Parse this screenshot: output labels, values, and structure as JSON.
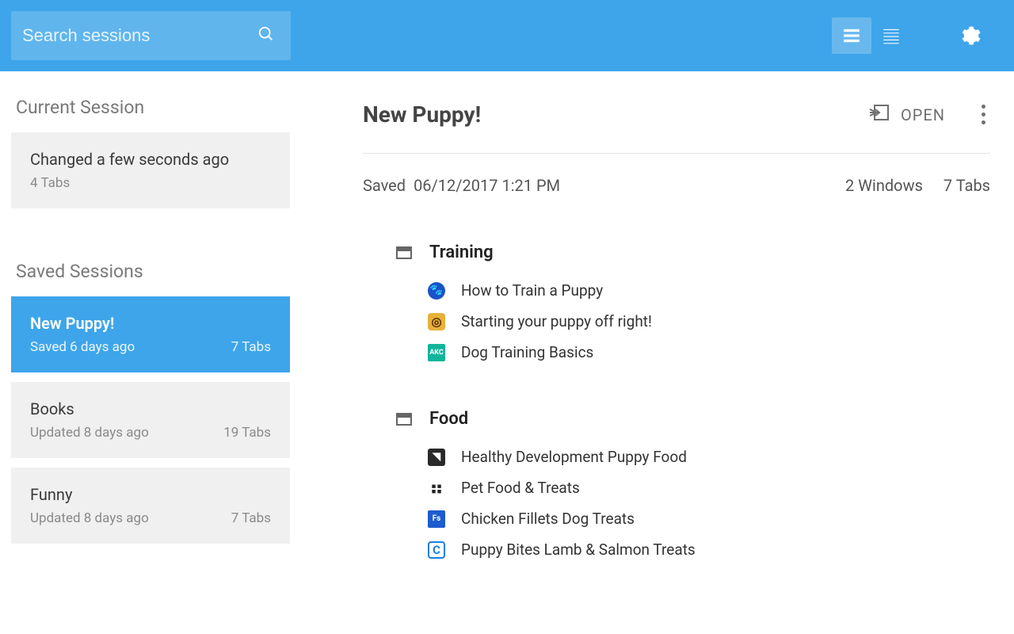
{
  "header": {
    "search_placeholder": "Search sessions"
  },
  "sidebar": {
    "current_label": "Current Session",
    "current": {
      "line1": "Changed a few seconds ago",
      "tabs": "4 Tabs"
    },
    "saved_label": "Saved Sessions",
    "saved": [
      {
        "title": "New Puppy!",
        "subtitle": "Saved 6 days ago",
        "tabs": "7 Tabs",
        "selected": true
      },
      {
        "title": "Books",
        "subtitle": "Updated 8 days ago",
        "tabs": "19 Tabs",
        "selected": false
      },
      {
        "title": "Funny",
        "subtitle": "Updated 8 days ago",
        "tabs": "7 Tabs",
        "selected": false
      }
    ]
  },
  "main": {
    "title": "New Puppy!",
    "open_label": "OPEN",
    "saved_label": "Saved",
    "saved_date": "06/12/2017 1:21 PM",
    "windows_count": "2 Windows",
    "tabs_count": "7 Tabs",
    "windows": [
      {
        "name": "Training",
        "tabs": [
          {
            "favicon": "fav-paw",
            "title": "How to Train a Puppy"
          },
          {
            "favicon": "fav-swirl",
            "title": "Starting your puppy off right!"
          },
          {
            "favicon": "fav-akc",
            "favtext": "AKC",
            "title": "Dog Training Basics"
          }
        ]
      },
      {
        "name": "Food",
        "tabs": [
          {
            "favicon": "fav-dog",
            "title": "Healthy Development Puppy Food"
          },
          {
            "favicon": "fav-paw2",
            "title": "Pet Food & Treats"
          },
          {
            "favicon": "fav-fs",
            "favtext": "Fs",
            "title": "Chicken Fillets Dog Treats"
          },
          {
            "favicon": "fav-c",
            "favtext": "C",
            "title": "Puppy Bites Lamb & Salmon Treats"
          }
        ]
      }
    ]
  }
}
